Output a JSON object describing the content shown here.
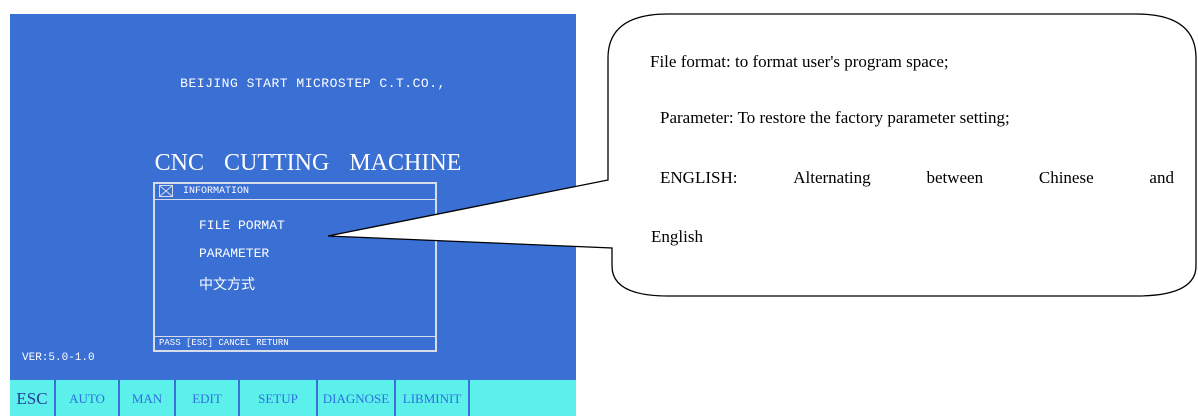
{
  "screen": {
    "company": "BEIJING START MICROSTEP C.T.CO.,",
    "machine": "CNC   CUTTING   MACHINE",
    "version": "VER:5.0-1.0",
    "dialog": {
      "title": "INFORMATION",
      "items": [
        "FILE PORMAT",
        "PARAMETER",
        "中文方式"
      ],
      "status": "PASS [ESC] CANCEL RETURN"
    },
    "function_keys": [
      "ESC",
      "AUTO",
      "MAN",
      "EDIT",
      "SETUP",
      "DIAGNOSE",
      "LIBMINIT"
    ]
  },
  "callout": {
    "line1": "File format: to format user's program space;",
    "line2": "Parameter: To restore the factory parameter setting;",
    "line3_words": [
      "ENGLISH:",
      "Alternating",
      "between",
      "Chinese",
      "and"
    ],
    "line4": "English"
  },
  "colors": {
    "screen_bg": "#3a6fd4",
    "function_bar": "#5bf0ea",
    "function_text": "#2f6fe0",
    "text": "#ffffff"
  }
}
